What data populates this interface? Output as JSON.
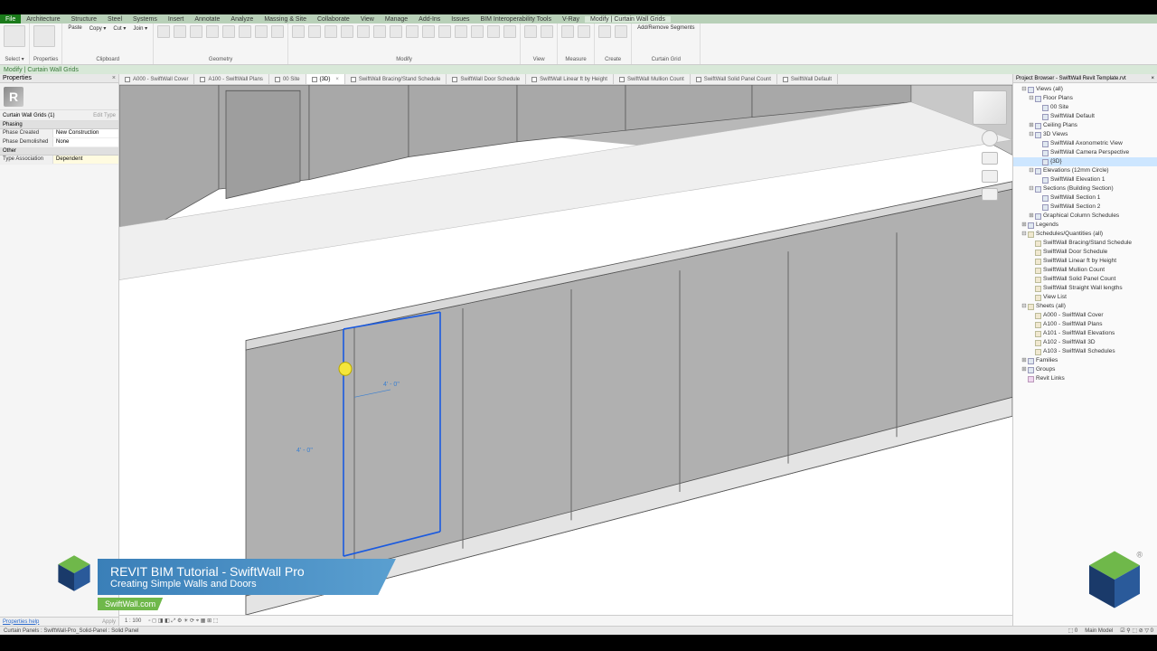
{
  "menu": {
    "file": "File",
    "tabs": [
      "Architecture",
      "Structure",
      "Steel",
      "Systems",
      "Insert",
      "Annotate",
      "Analyze",
      "Massing & Site",
      "Collaborate",
      "View",
      "Manage",
      "Add-Ins",
      "Issues",
      "BIM Interoperability Tools",
      "V-Ray",
      "Modify | Curtain Wall Grids"
    ]
  },
  "context_label": "Modify | Curtain Wall Grids",
  "ribbon": {
    "groups": [
      {
        "label": "Select ▾",
        "big": true
      },
      {
        "label": "Properties",
        "big": true
      },
      {
        "label": "Clipboard",
        "items": [
          "Paste",
          "Copy ▾",
          "Cut ▾",
          "Join ▾"
        ]
      },
      {
        "label": "Geometry",
        "icons": 8
      },
      {
        "label": "Modify",
        "icons": 14
      },
      {
        "label": "View",
        "icons": 2
      },
      {
        "label": "Measure",
        "icons": 2
      },
      {
        "label": "Create",
        "icons": 2
      },
      {
        "label": "Curtain Grid",
        "text": "Add/Remove Segments"
      }
    ]
  },
  "properties": {
    "panel_title": "Properties",
    "type_selector": "Curtain Wall Grids (1)",
    "edit_type": "Edit Type",
    "sections": {
      "phasing": "Phasing",
      "other": "Other"
    },
    "rows": [
      {
        "k": "Phase Created",
        "v": "New Construction"
      },
      {
        "k": "Phase Demolished",
        "v": "None"
      },
      {
        "k": "Type Association",
        "v": "Dependent",
        "sel": true
      }
    ],
    "help": "Properties help",
    "apply": "Apply"
  },
  "doctabs": [
    {
      "label": "A000 - SwiftWall Cover",
      "active": false
    },
    {
      "label": "A100 - SwiftWall Plans",
      "active": false
    },
    {
      "label": "00 Site",
      "active": false
    },
    {
      "label": "{3D}",
      "active": true,
      "close": true
    },
    {
      "label": "SwiftWall Bracing/Stand Schedule",
      "active": false
    },
    {
      "label": "SwiftWall Door Schedule",
      "active": false
    },
    {
      "label": "SwiftWall Linear ft by Height",
      "active": false
    },
    {
      "label": "SwiftWall Mullion Count",
      "active": false
    },
    {
      "label": "SwiftWall Solid Panel Count",
      "active": false
    },
    {
      "label": "SwiftWall Default",
      "active": false
    }
  ],
  "viewbar": {
    "scale": "1 : 100"
  },
  "dims": {
    "a": "4' - 0\"",
    "b": "4' - 0\""
  },
  "browser": {
    "title": "Project Browser - SwiftWall Revit Template.rvt",
    "tree": [
      {
        "l": "Views (all)",
        "d": 0,
        "exp": "-"
      },
      {
        "l": "Floor Plans",
        "d": 1,
        "exp": "-"
      },
      {
        "l": "00 Site",
        "d": 2
      },
      {
        "l": "SwiftWall Default",
        "d": 2
      },
      {
        "l": "Ceiling Plans",
        "d": 1,
        "exp": "+"
      },
      {
        "l": "3D Views",
        "d": 1,
        "exp": "-"
      },
      {
        "l": "SwiftWall Axonometric View",
        "d": 2
      },
      {
        "l": "SwiftWall Camera Perspective",
        "d": 2
      },
      {
        "l": "{3D}",
        "d": 2,
        "sel": true
      },
      {
        "l": "Elevations (12mm Circle)",
        "d": 1,
        "exp": "-"
      },
      {
        "l": "SwiftWall Elevation 1",
        "d": 2
      },
      {
        "l": "Sections (Building Section)",
        "d": 1,
        "exp": "-"
      },
      {
        "l": "SwiftWall Section 1",
        "d": 2
      },
      {
        "l": "SwiftWall Section 2",
        "d": 2
      },
      {
        "l": "Graphical Column Schedules",
        "d": 1,
        "exp": "+"
      },
      {
        "l": "Legends",
        "d": 0,
        "exp": "+"
      },
      {
        "l": "Schedules/Quantities (all)",
        "d": 0,
        "exp": "-",
        "ico": "sh"
      },
      {
        "l": "SwiftWall Bracing/Stand Schedule",
        "d": 1,
        "ico": "sh"
      },
      {
        "l": "SwiftWall Door Schedule",
        "d": 1,
        "ico": "sh"
      },
      {
        "l": "SwiftWall Linear ft by Height",
        "d": 1,
        "ico": "sh"
      },
      {
        "l": "SwiftWall Mullion Count",
        "d": 1,
        "ico": "sh"
      },
      {
        "l": "SwiftWall Solid Panel Count",
        "d": 1,
        "ico": "sh"
      },
      {
        "l": "SwiftWall Straight Wall lengths",
        "d": 1,
        "ico": "sh"
      },
      {
        "l": "View List",
        "d": 1,
        "ico": "sh"
      },
      {
        "l": "Sheets (all)",
        "d": 0,
        "exp": "-",
        "ico": "sh"
      },
      {
        "l": "A000 - SwiftWall Cover",
        "d": 1,
        "ico": "sh"
      },
      {
        "l": "A100 - SwiftWall Plans",
        "d": 1,
        "ico": "sh"
      },
      {
        "l": "A101 - SwiftWall Elevations",
        "d": 1,
        "ico": "sh"
      },
      {
        "l": "A102 - SwiftWall 3D",
        "d": 1,
        "ico": "sh"
      },
      {
        "l": "A103 - SwiftWall Schedules",
        "d": 1,
        "ico": "sh"
      },
      {
        "l": "Families",
        "d": 0,
        "exp": "+"
      },
      {
        "l": "Groups",
        "d": 0,
        "exp": "+"
      },
      {
        "l": "Revit Links",
        "d": 0,
        "ico": "ln"
      }
    ]
  },
  "status": {
    "left": "Curtain Panels : SwiftWall-Pro_Solid-Panel : Solid Panel",
    "model": "Main Model"
  },
  "banner": {
    "title": "REVIT BIM Tutorial - SwiftWall Pro",
    "subtitle": "Creating Simple Walls and Doors",
    "tag": "SwiftWall.com"
  }
}
